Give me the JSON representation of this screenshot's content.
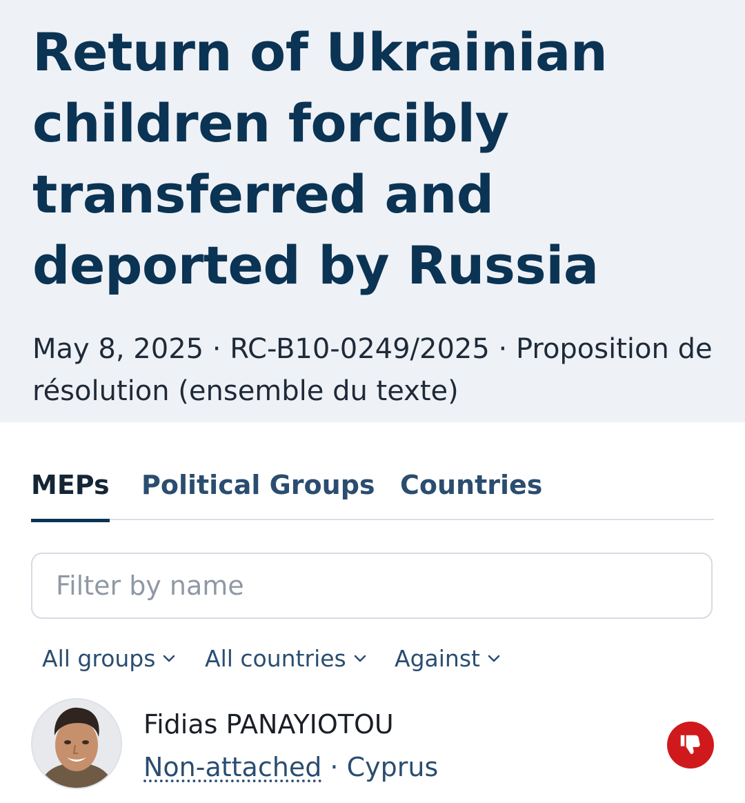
{
  "header": {
    "title": "Return of Ukrainian children forcibly transferred and deported by Russia",
    "meta": "May 8, 2025 · RC-B10-0249/2025 · Proposition de résolution (ensemble du texte)"
  },
  "tabs": [
    {
      "label": "MEPs",
      "active": true
    },
    {
      "label": "Political Groups",
      "active": false
    },
    {
      "label": "Countries",
      "active": false
    }
  ],
  "search": {
    "placeholder": "Filter by name",
    "value": ""
  },
  "filters": {
    "groups": "All groups",
    "countries": "All countries",
    "position": "Against"
  },
  "results": [
    {
      "name": "Fidias PANAYIOTOU",
      "group": "Non-attached",
      "separator": "·",
      "country": "Cyprus",
      "vote_icon": "thumbs-down-icon"
    }
  ],
  "colors": {
    "header_bg": "#eef1f6",
    "title_text": "#0b3353",
    "link_text": "#2a4d70",
    "vote_against": "#d0191c"
  }
}
